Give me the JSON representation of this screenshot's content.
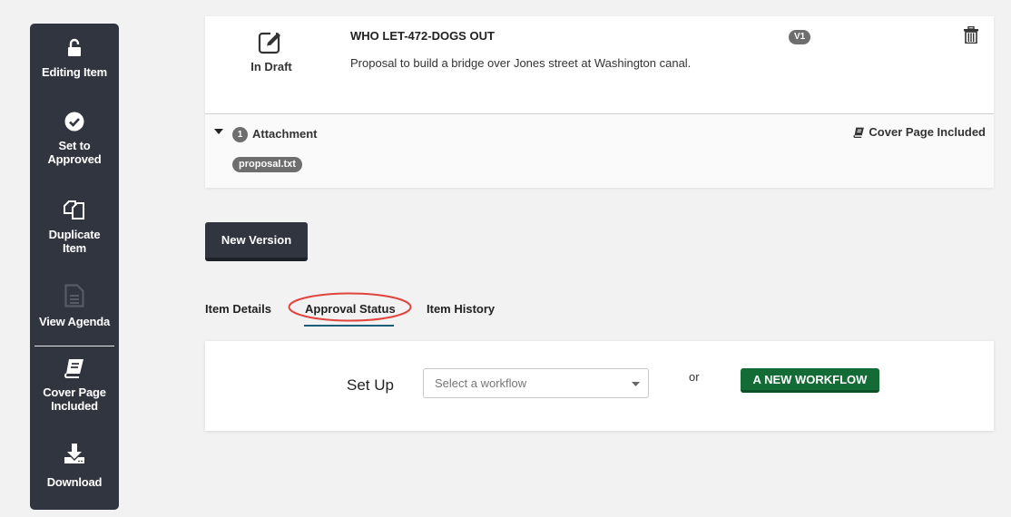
{
  "sidebar": {
    "items": [
      {
        "icon": "unlock-icon",
        "label": "Editing Item"
      },
      {
        "icon": "check-circle-icon",
        "label": "Set to Approved"
      },
      {
        "icon": "duplicate-icon",
        "label": "Duplicate Item"
      },
      {
        "icon": "document-icon",
        "label": "View Agenda"
      },
      {
        "icon": "book-icon",
        "label": "Cover Page Included"
      },
      {
        "icon": "download-icon",
        "label": "Download"
      }
    ]
  },
  "item": {
    "status": "In Draft",
    "title": "WHO LET-472-DOGS OUT",
    "description": "Proposal to build a bridge over Jones street at Washington canal.",
    "version": "V1",
    "attachments": {
      "count": "1",
      "label": "Attachment",
      "files": [
        "proposal.txt"
      ]
    },
    "cover_page": "Cover Page Included"
  },
  "actions": {
    "new_version": "New Version"
  },
  "tabs": [
    {
      "label": "Item Details",
      "active": false
    },
    {
      "label": "Approval Status",
      "active": true
    },
    {
      "label": "Item History",
      "active": false
    }
  ],
  "setup": {
    "label": "Set Up",
    "select_placeholder": "Select a workflow",
    "or": "or",
    "new_workflow": "A NEW WORKFLOW"
  },
  "colors": {
    "sidebar_bg": "#30353f",
    "accent_tab": "#1b5e7a",
    "primary_green": "#136b35",
    "annotation_red": "#e0443c",
    "badge_gray": "#6e6e6e"
  }
}
